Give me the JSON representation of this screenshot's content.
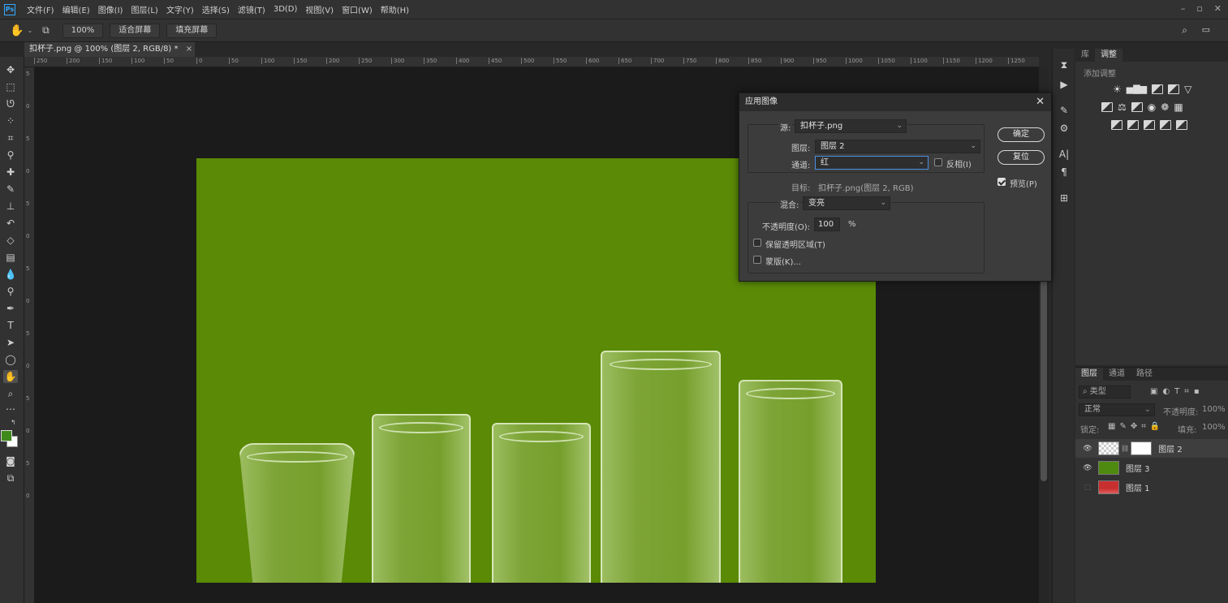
{
  "app": {
    "logo": "Ps"
  },
  "menu": [
    "文件(F)",
    "编辑(E)",
    "图像(I)",
    "图层(L)",
    "文字(Y)",
    "选择(S)",
    "滤镜(T)",
    "3D(D)",
    "视图(V)",
    "窗口(W)",
    "帮助(H)"
  ],
  "options_bar": {
    "zoom": "100%",
    "fit_screen": "适合屏幕",
    "fill_screen": "填充屏幕"
  },
  "document": {
    "tab_title": "扣杯子.png @ 100% (图层 2, RGB/8) *",
    "tab_close": "×"
  },
  "rulers": {
    "h_ticks": [
      "250",
      "200",
      "150",
      "100",
      "50",
      "0",
      "50",
      "100",
      "150",
      "200",
      "250",
      "300",
      "350",
      "400",
      "450",
      "500",
      "550",
      "600",
      "650",
      "700",
      "750",
      "800",
      "850",
      "900",
      "950",
      "1000",
      "1050",
      "1100",
      "1150",
      "1200",
      "1250"
    ],
    "v_ticks": [
      "5",
      "0",
      "5",
      "0",
      "5",
      "0",
      "5",
      "0",
      "5",
      "0",
      "5",
      "0",
      "5",
      "0"
    ]
  },
  "colors": {
    "image_bg": "#5a8a06",
    "foreground": "#3f8a1a",
    "background": "#ffffff"
  },
  "right_panels": {
    "tabs": [
      "库",
      "调整"
    ],
    "add_adjustment": "添加调整",
    "layer_tabs": [
      "图层",
      "通道",
      "路径"
    ],
    "kind_filter": "类型",
    "blend_mode": "正常",
    "opacity_label": "不透明度:",
    "opacity_value": "100%",
    "lock_label": "锁定:",
    "fill_label": "填充:",
    "fill_value": "100%",
    "layers": [
      {
        "name": "图层 2",
        "visible": true
      },
      {
        "name": "图层 3",
        "visible": true
      },
      {
        "name": "图层 1",
        "visible": false
      }
    ]
  },
  "dialog": {
    "title": "应用图像",
    "close": "✕",
    "source_label": "源:",
    "source_value": "扣杯子.png",
    "layer_label": "图层:",
    "layer_value": "图层 2",
    "channel_label": "通道:",
    "channel_value": "红",
    "invert_label": "反相(I)",
    "target_label": "目标:",
    "target_value": "扣杯子.png(图层 2, RGB)",
    "blend_label": "混合:",
    "blend_value": "变亮",
    "opacity_label": "不透明度(O):",
    "opacity_value": "100",
    "percent": "%",
    "preserve_label": "保留透明区域(T)",
    "mask_label": "蒙版(K)...",
    "ok": "确定",
    "reset": "复位",
    "preview_label": "预览(P)",
    "invert_checked": false,
    "preview_checked": true,
    "preserve_checked": false,
    "mask_checked": false
  }
}
